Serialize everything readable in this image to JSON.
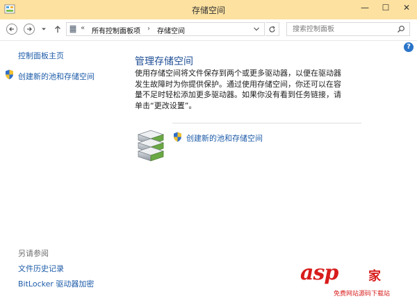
{
  "window": {
    "title": "存储空间",
    "controls": {
      "minimize": "—",
      "maximize": "☐",
      "close": "✕"
    }
  },
  "nav": {
    "breadcrumb_prefix": "«",
    "breadcrumbs": [
      "所有控制面板项",
      "存储空间"
    ],
    "breadcrumb_sep": "›",
    "search_placeholder": "搜索控制面板"
  },
  "left_pane": {
    "home": "控制面板主页",
    "create_pool": "创建新的池和存储空间",
    "see_also_heading": "另请参阅",
    "see_also": [
      "文件历史记录",
      "BitLocker 驱动器加密"
    ]
  },
  "main": {
    "title": "管理存储空间",
    "description": "使用存储空间将文件保存到两个或更多驱动器，以便在驱动器发生故障时为你提供保护。通过使用存储空间，你还可以在容量不足时轻松添加更多驱动器。如果你没有看到任务链接，请单击“更改设置”。",
    "task_link": "创建新的池和存储空间"
  },
  "help": {
    "label": "?"
  },
  "watermark": {
    "brand": "asp",
    "brand2": "家",
    "sub": "免费网站源码下载站"
  },
  "colors": {
    "titlebar": "#fce1a0",
    "link": "#1c5ba8",
    "heading": "#1e4e95",
    "help": "#2a74c9",
    "watermark": "#d81c1c"
  }
}
